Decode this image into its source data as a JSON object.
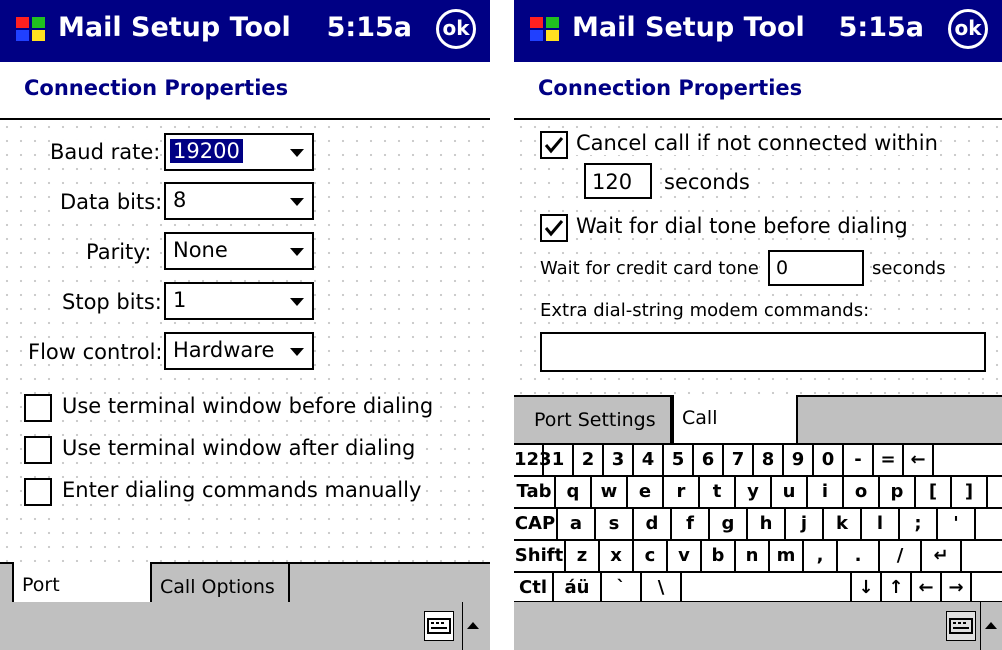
{
  "screens": [
    {
      "app_title": "Mail Setup Tool",
      "clock": "5:15a",
      "ok_label": "ok",
      "heading": "Connection Properties",
      "fields": {
        "baud_label": "Baud rate:",
        "baud_value": "19200",
        "data_bits_label": "Data bits:",
        "data_bits_value": "8",
        "parity_label": "Parity:",
        "parity_value": "None",
        "stop_bits_label": "Stop bits:",
        "stop_bits_value": "1",
        "flow_label": "Flow control:",
        "flow_value": "Hardware"
      },
      "checkboxes": [
        {
          "label": "Use terminal window before dialing",
          "checked": false
        },
        {
          "label": "Use terminal window after dialing",
          "checked": false
        },
        {
          "label": "Enter dialing commands manually",
          "checked": false
        }
      ],
      "tabs": [
        "Port Settings",
        "Call Options"
      ],
      "active_tab": "Port Settings"
    },
    {
      "app_title": "Mail Setup Tool",
      "clock": "5:15a",
      "ok_label": "ok",
      "heading": "Connection Properties",
      "cancel_call_label": "Cancel call if not connected within",
      "cancel_call_checked": true,
      "cancel_seconds_value": "120",
      "seconds_label": "seconds",
      "wait_dial_tone_label": "Wait for dial tone before dialing",
      "wait_dial_tone_checked": true,
      "credit_card_label": "Wait for credit card tone",
      "credit_card_value": "0",
      "credit_seconds_label": "seconds",
      "extra_label": "Extra dial-string modem commands:",
      "extra_value": "",
      "tabs": [
        "Port Settings",
        "Call Options"
      ],
      "active_tab": "Call Options",
      "keyboard_rows": [
        [
          "123",
          "1",
          "2",
          "3",
          "4",
          "5",
          "6",
          "7",
          "8",
          "9",
          "0",
          "-",
          "=",
          "←"
        ],
        [
          "Tab",
          "q",
          "w",
          "e",
          "r",
          "t",
          "y",
          "u",
          "i",
          "o",
          "p",
          "[",
          "]"
        ],
        [
          "CAP",
          "a",
          "s",
          "d",
          "f",
          "g",
          "h",
          "j",
          "k",
          "l",
          ";",
          "'"
        ],
        [
          "Shift",
          "z",
          "x",
          "c",
          "v",
          "b",
          "n",
          "m",
          ",",
          ".",
          "/",
          "↵"
        ],
        [
          "Ctl",
          "áü",
          "`",
          "\\",
          " ",
          "↓",
          "↑",
          "←",
          "→"
        ]
      ]
    }
  ],
  "colors": {
    "titlebar": "#000084",
    "heading_text": "#000084",
    "bar_gray": "#c0c0c0"
  }
}
